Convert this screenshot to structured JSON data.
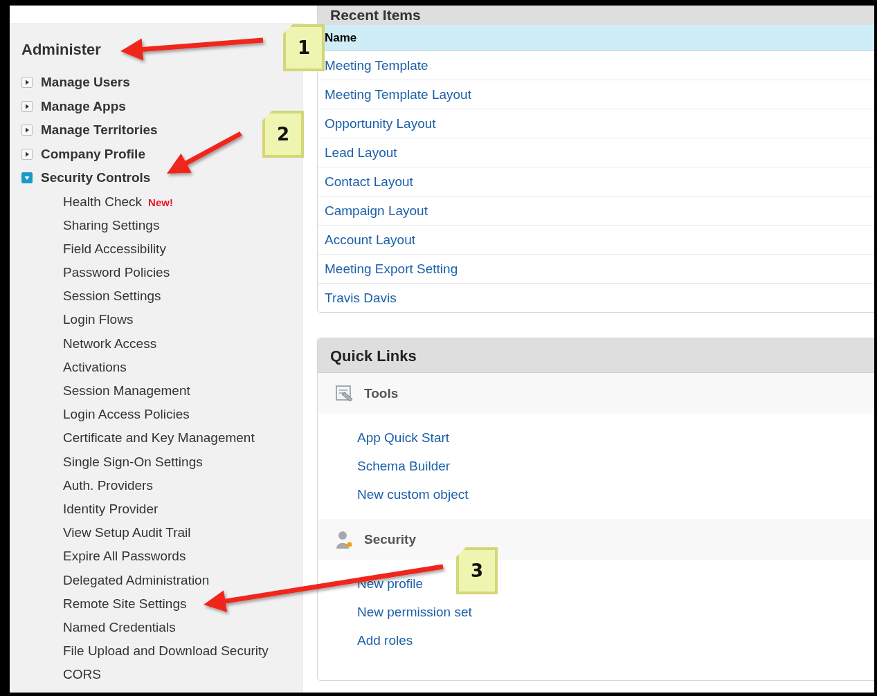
{
  "sidebar": {
    "title": "Administer",
    "sections": [
      {
        "label": "Manage Users",
        "expanded": false
      },
      {
        "label": "Manage Apps",
        "expanded": false
      },
      {
        "label": "Manage Territories",
        "expanded": false
      },
      {
        "label": "Company Profile",
        "expanded": false
      },
      {
        "label": "Security Controls",
        "expanded": true,
        "children": [
          {
            "label": "Health Check",
            "badge": "New!"
          },
          {
            "label": "Sharing Settings"
          },
          {
            "label": "Field Accessibility"
          },
          {
            "label": "Password Policies"
          },
          {
            "label": "Session Settings"
          },
          {
            "label": "Login Flows"
          },
          {
            "label": "Network Access"
          },
          {
            "label": "Activations"
          },
          {
            "label": "Session Management"
          },
          {
            "label": "Login Access Policies"
          },
          {
            "label": "Certificate and Key Management"
          },
          {
            "label": "Single Sign-On Settings"
          },
          {
            "label": "Auth. Providers"
          },
          {
            "label": "Identity Provider"
          },
          {
            "label": "View Setup Audit Trail"
          },
          {
            "label": "Expire All Passwords"
          },
          {
            "label": "Delegated Administration"
          },
          {
            "label": "Remote Site Settings"
          },
          {
            "label": "Named Credentials"
          },
          {
            "label": "File Upload and Download Security"
          },
          {
            "label": "CORS"
          }
        ]
      }
    ]
  },
  "recent_items": {
    "title": "Recent Items",
    "column": "Name",
    "rows": [
      "Meeting Template",
      "Meeting Template Layout",
      "Opportunity Layout",
      "Lead Layout",
      "Contact Layout",
      "Campaign Layout",
      "Account Layout",
      "Meeting Export Setting",
      "Travis Davis"
    ]
  },
  "quick_links": {
    "title": "Quick Links",
    "groups": [
      {
        "kind": "tools",
        "title": "Tools",
        "links": [
          "App Quick Start",
          "Schema Builder",
          "New custom object"
        ]
      },
      {
        "kind": "security",
        "title": "Security",
        "links": [
          "New profile",
          "New permission set",
          "Add roles"
        ]
      }
    ]
  },
  "annotations": [
    "1",
    "2",
    "3"
  ]
}
